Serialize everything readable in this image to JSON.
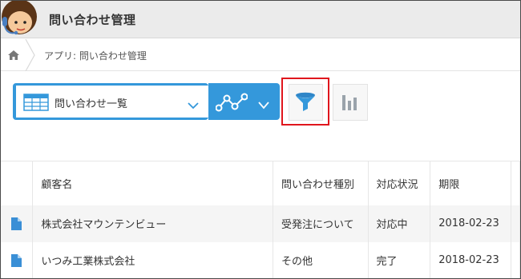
{
  "header": {
    "title": "問い合わせ管理",
    "avatar": "support-agent-avatar-icon"
  },
  "breadcrumb": {
    "home_icon": "home-icon",
    "text": "アプリ: 問い合わせ管理"
  },
  "toolbar": {
    "view_label": "問い合わせ一覧",
    "view_icon": "table-list-icon",
    "graph_icon": "graph-nodes-icon",
    "filter_icon": "filter-funnel-icon",
    "chart_icon": "bar-chart-icon",
    "accent_color": "#3498db",
    "highlight_color": "#e0161d"
  },
  "table": {
    "columns": [
      "顧客名",
      "問い合わせ種別",
      "対応状況",
      "期限"
    ],
    "rows": [
      {
        "customer": "株式会社マウンテンビュー",
        "type": "受発注について",
        "status": "対応中",
        "due": "2018-02-23"
      },
      {
        "customer": "いつみ工業株式会社",
        "type": "その他",
        "status": "完了",
        "due": "2018-02-23"
      }
    ]
  }
}
